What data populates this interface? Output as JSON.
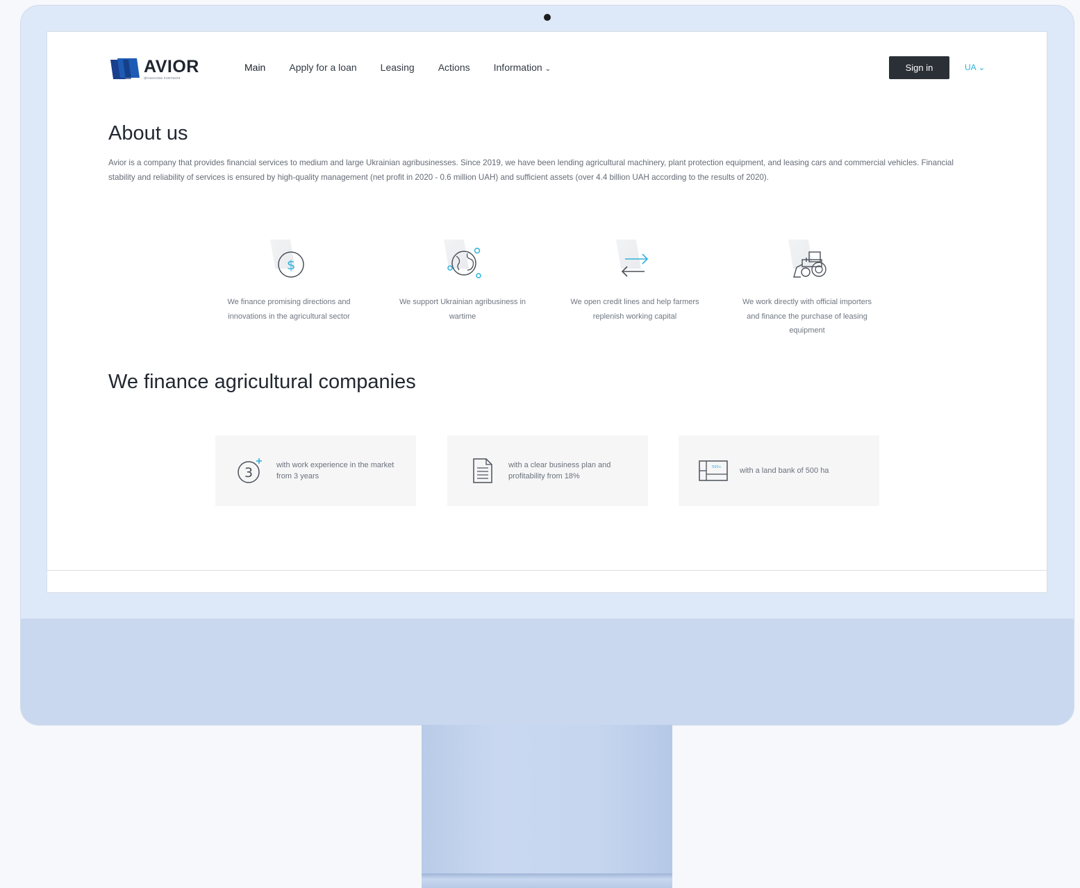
{
  "nav": {
    "logo_text": "AVIOR",
    "logo_subtext": "фінансова компанія",
    "links": [
      "Main",
      "Apply for a loan",
      "Leasing",
      "Actions",
      "Information"
    ],
    "signin_label": "Sign in",
    "language": "UA"
  },
  "about": {
    "title": "About us",
    "text": "Avior is a company that provides financial services to medium and large Ukrainian agribusinesses. Since 2019, we have been lending agricultural machinery, plant protection equipment, and leasing cars and commercial vehicles. Financial stability and reliability of services is ensured by high-quality management (net profit in 2020 - 0.6 million UAH) and sufficient assets (over 4.4 billion UAH according to the results of 2020)."
  },
  "features": [
    {
      "icon": "dollar-coin-icon",
      "text": "We finance promising directions and innovations in the agricultural sector"
    },
    {
      "icon": "globe-gears-icon",
      "text": "We support Ukrainian agribusiness in wartime"
    },
    {
      "icon": "exchange-arrows-icon",
      "text": "We open credit lines and help farmers replenish working capital"
    },
    {
      "icon": "tractor-icon",
      "text": "We work directly with official importers and finance the purchase of leasing equipment"
    }
  ],
  "finance": {
    "title": "We finance agricultural companies",
    "cards": [
      {
        "icon": "three-plus-icon",
        "text": "with work experience in the market from 3 years"
      },
      {
        "icon": "document-icon",
        "text": "with a clear business plan and profitability from 18%"
      },
      {
        "icon": "land-plot-icon",
        "icon_label": "500+",
        "text": "with a land bank of 500 ha"
      }
    ]
  },
  "colors": {
    "accent": "#2fb0dc",
    "logo_blue": "#1e5bb5",
    "button_dark": "#2b2f36",
    "monitor": "#dde9f8"
  }
}
